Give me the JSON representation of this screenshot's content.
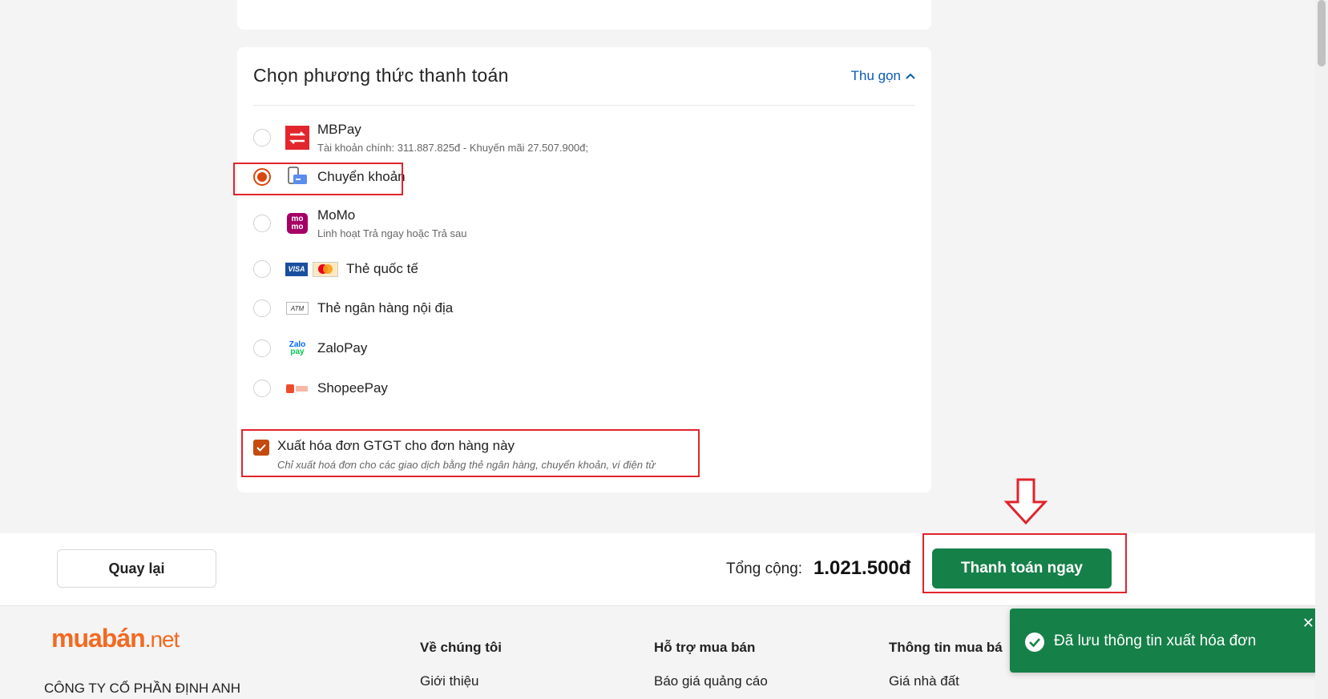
{
  "payment": {
    "title": "Chọn phương thức thanh toán",
    "collapse_label": "Thu gọn",
    "options": [
      {
        "name": "MBPay",
        "sub": "Tài khoản chính: 311.887.825đ - Khuyến mãi 27.507.900đ;",
        "selected": false,
        "icon": "mbpay-icon"
      },
      {
        "name": "Chuyển khoản",
        "sub": "",
        "selected": true,
        "icon": "bank-transfer-icon"
      },
      {
        "name": "MoMo",
        "sub": "Linh hoạt Trả ngay hoặc Trả sau",
        "selected": false,
        "icon": "momo-icon"
      },
      {
        "name": "Thẻ quốc tế",
        "sub": "",
        "selected": false,
        "icon": "visa-mastercard-icon"
      },
      {
        "name": "Thẻ ngân hàng nội địa",
        "sub": "",
        "selected": false,
        "icon": "atm-icon"
      },
      {
        "name": "ZaloPay",
        "sub": "",
        "selected": false,
        "icon": "zalopay-icon"
      },
      {
        "name": "ShopeePay",
        "sub": "",
        "selected": false,
        "icon": "shopeepay-icon"
      }
    ],
    "invoice": {
      "checked": true,
      "label": "Xuất hóa đơn GTGT cho đơn hàng này",
      "note": "Chỉ xuất hoá đơn cho các giao dịch bằng thẻ ngân hàng, chuyển khoản, ví điện tử"
    }
  },
  "checkout": {
    "back_label": "Quay lại",
    "total_label": "Tổng cộng:",
    "total_value": "1.021.500đ",
    "pay_label": "Thanh toán ngay"
  },
  "icons": {
    "mbpay": {
      "visa": "VISA",
      "atm": "ATM",
      "zalo_top": "Zalo",
      "zalo_bottom": "pay",
      "momo_top": "mo",
      "momo_bottom": "mo"
    }
  },
  "footer": {
    "logo_main": "muabán",
    "logo_suffix": ".net",
    "company": "CÔNG TY CỔ PHẦN ĐỊNH ANH",
    "columns": [
      {
        "heading": "Về chúng tôi",
        "link": "Giới thiệu"
      },
      {
        "heading": "Hỗ trợ mua bán",
        "link": "Báo giá quảng cáo"
      },
      {
        "heading": "Thông tin mua bá",
        "link": "Giá nhà đất"
      }
    ]
  },
  "toast": {
    "message": "Đã lưu thông tin xuất hóa đơn",
    "close": "✕"
  },
  "colors": {
    "accent_green": "#168049",
    "selected_orange": "#d9480f",
    "highlight_red": "#e0242c",
    "link_blue": "#0a5bb5"
  }
}
